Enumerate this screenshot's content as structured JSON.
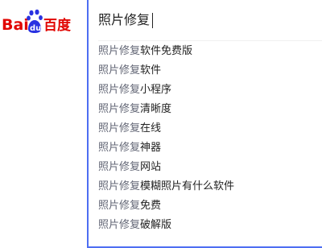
{
  "logo": {
    "text_bai": "Bai",
    "text_du": "du",
    "text_cn": "百度"
  },
  "search": {
    "query": "照片修复"
  },
  "suggestions": [
    {
      "query": "照片修复",
      "rest": "软件免费版"
    },
    {
      "query": "照片修复",
      "rest": "软件"
    },
    {
      "query": "照片修复",
      "rest": "小程序"
    },
    {
      "query": "照片修复",
      "rest": "清晰度"
    },
    {
      "query": "照片修复",
      "rest": "在线"
    },
    {
      "query": "照片修复",
      "rest": "神器"
    },
    {
      "query": "照片修复",
      "rest": "网站"
    },
    {
      "query": "照片修复",
      "rest": "模糊照片有什么软件"
    },
    {
      "query": "照片修复",
      "rest": "免费"
    },
    {
      "query": "照片修复",
      "rest": "破解版"
    }
  ],
  "colors": {
    "brand_red": "#e10602",
    "brand_blue": "#2932e1",
    "search_border": "#4e6ef2",
    "suggest_text": "#222222"
  }
}
